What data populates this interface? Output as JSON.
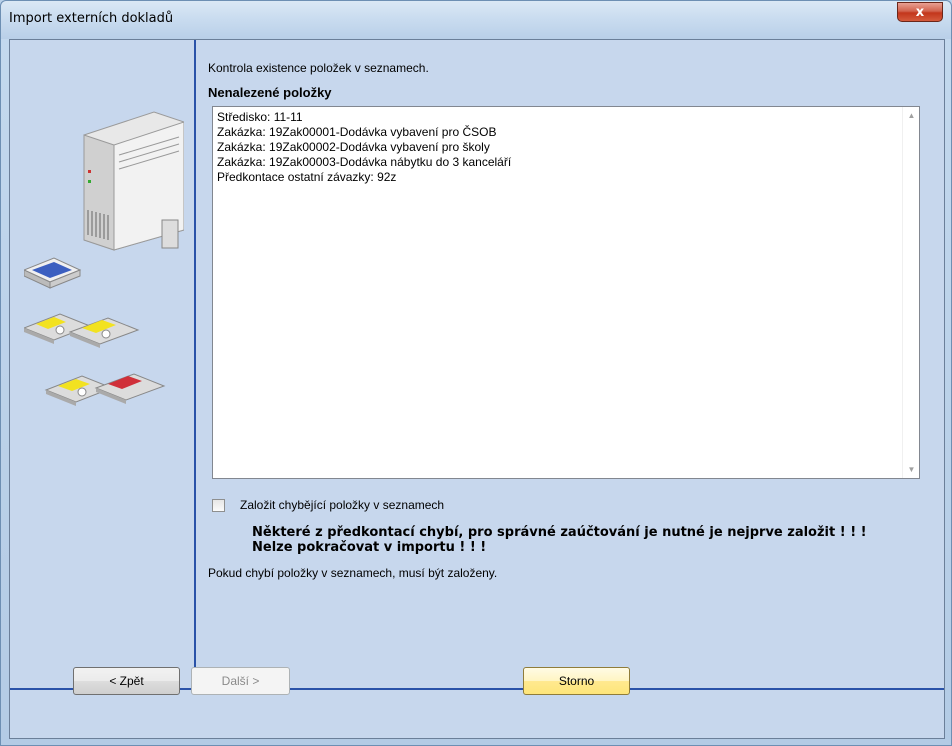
{
  "window": {
    "title": "Import externích dokladů",
    "close_label": "x"
  },
  "main": {
    "check_label": "Kontrola existence položek v seznamech.",
    "section_title": "Nenalezené položky",
    "items": [
      "Středisko: 11-11",
      "Zakázka: 19Zak00001-Dodávka vybavení pro ČSOB",
      "Zakázka: 19Zak00002-Dodávka vybavení pro školy",
      "Zakázka: 19Zak00003-Dodávka nábytku do 3 kanceláří",
      "Předkontace ostatní závazky: 92z"
    ],
    "create_checkbox_label": "Založit chybějící položky v seznamech",
    "create_checkbox_checked": false,
    "warning_line1": "Některé z předkontací chybí, pro správné zaúčtování je nutné je nejprve založit ! ! !",
    "warning_line2": "Nelze pokračovat v importu ! ! !",
    "info_text": "Pokud chybí položky v seznamech, musí být založeny."
  },
  "buttons": {
    "back": "< Zpět",
    "next": "Další >",
    "cancel": "Storno"
  },
  "colors": {
    "panel_bg": "#c7d7ed",
    "separator": "#2a52a8",
    "close_red": "#c3361c"
  },
  "icons": {
    "illustration": "computer-and-disks-illustration",
    "scroll_up": "scroll-up-icon",
    "scroll_down": "scroll-down-icon"
  }
}
